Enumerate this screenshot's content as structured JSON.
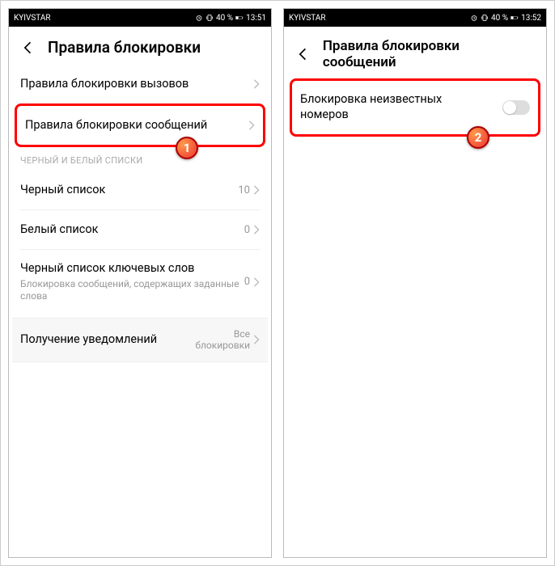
{
  "left": {
    "status": {
      "carrier": "KYIVSTAR",
      "battery": "40 %",
      "time": "13:51"
    },
    "title": "Правила блокировки",
    "items": {
      "calls": "Правила блокировки вызовов",
      "messages": "Правила блокировки сообщений"
    },
    "sectionHeader": "ЧЕРНЫЙ И БЕЛЫЙ СПИСКИ",
    "blacklist": {
      "label": "Черный список",
      "value": "10"
    },
    "whitelist": {
      "label": "Белый список",
      "value": "0"
    },
    "keywords": {
      "label": "Черный список ключевых слов",
      "sub": "Блокировка сообщений, содержащих заданные слова",
      "value": "0"
    },
    "notif": {
      "label": "Получение уведомлений",
      "value": "Все блокировки"
    },
    "badge": "1"
  },
  "right": {
    "status": {
      "carrier": "KYIVSTAR",
      "battery": "40 %",
      "time": "13:52"
    },
    "title": "Правила блокировки сообщений",
    "toggleLabel": "Блокировка неизвестных номеров",
    "badge": "2"
  }
}
